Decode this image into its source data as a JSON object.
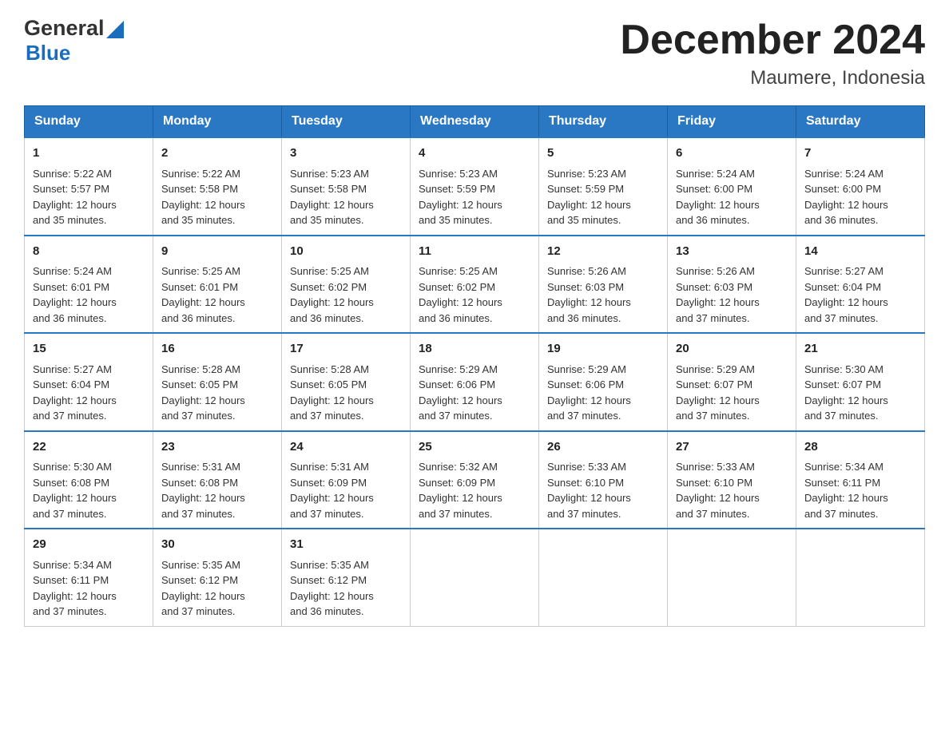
{
  "header": {
    "title": "December 2024",
    "location": "Maumere, Indonesia",
    "logo_general": "General",
    "logo_blue": "Blue"
  },
  "days_of_week": [
    "Sunday",
    "Monday",
    "Tuesday",
    "Wednesday",
    "Thursday",
    "Friday",
    "Saturday"
  ],
  "weeks": [
    [
      {
        "day": "1",
        "sunrise": "5:22 AM",
        "sunset": "5:57 PM",
        "daylight": "12 hours and 35 minutes."
      },
      {
        "day": "2",
        "sunrise": "5:22 AM",
        "sunset": "5:58 PM",
        "daylight": "12 hours and 35 minutes."
      },
      {
        "day": "3",
        "sunrise": "5:23 AM",
        "sunset": "5:58 PM",
        "daylight": "12 hours and 35 minutes."
      },
      {
        "day": "4",
        "sunrise": "5:23 AM",
        "sunset": "5:59 PM",
        "daylight": "12 hours and 35 minutes."
      },
      {
        "day": "5",
        "sunrise": "5:23 AM",
        "sunset": "5:59 PM",
        "daylight": "12 hours and 35 minutes."
      },
      {
        "day": "6",
        "sunrise": "5:24 AM",
        "sunset": "6:00 PM",
        "daylight": "12 hours and 36 minutes."
      },
      {
        "day": "7",
        "sunrise": "5:24 AM",
        "sunset": "6:00 PM",
        "daylight": "12 hours and 36 minutes."
      }
    ],
    [
      {
        "day": "8",
        "sunrise": "5:24 AM",
        "sunset": "6:01 PM",
        "daylight": "12 hours and 36 minutes."
      },
      {
        "day": "9",
        "sunrise": "5:25 AM",
        "sunset": "6:01 PM",
        "daylight": "12 hours and 36 minutes."
      },
      {
        "day": "10",
        "sunrise": "5:25 AM",
        "sunset": "6:02 PM",
        "daylight": "12 hours and 36 minutes."
      },
      {
        "day": "11",
        "sunrise": "5:25 AM",
        "sunset": "6:02 PM",
        "daylight": "12 hours and 36 minutes."
      },
      {
        "day": "12",
        "sunrise": "5:26 AM",
        "sunset": "6:03 PM",
        "daylight": "12 hours and 36 minutes."
      },
      {
        "day": "13",
        "sunrise": "5:26 AM",
        "sunset": "6:03 PM",
        "daylight": "12 hours and 37 minutes."
      },
      {
        "day": "14",
        "sunrise": "5:27 AM",
        "sunset": "6:04 PM",
        "daylight": "12 hours and 37 minutes."
      }
    ],
    [
      {
        "day": "15",
        "sunrise": "5:27 AM",
        "sunset": "6:04 PM",
        "daylight": "12 hours and 37 minutes."
      },
      {
        "day": "16",
        "sunrise": "5:28 AM",
        "sunset": "6:05 PM",
        "daylight": "12 hours and 37 minutes."
      },
      {
        "day": "17",
        "sunrise": "5:28 AM",
        "sunset": "6:05 PM",
        "daylight": "12 hours and 37 minutes."
      },
      {
        "day": "18",
        "sunrise": "5:29 AM",
        "sunset": "6:06 PM",
        "daylight": "12 hours and 37 minutes."
      },
      {
        "day": "19",
        "sunrise": "5:29 AM",
        "sunset": "6:06 PM",
        "daylight": "12 hours and 37 minutes."
      },
      {
        "day": "20",
        "sunrise": "5:29 AM",
        "sunset": "6:07 PM",
        "daylight": "12 hours and 37 minutes."
      },
      {
        "day": "21",
        "sunrise": "5:30 AM",
        "sunset": "6:07 PM",
        "daylight": "12 hours and 37 minutes."
      }
    ],
    [
      {
        "day": "22",
        "sunrise": "5:30 AM",
        "sunset": "6:08 PM",
        "daylight": "12 hours and 37 minutes."
      },
      {
        "day": "23",
        "sunrise": "5:31 AM",
        "sunset": "6:08 PM",
        "daylight": "12 hours and 37 minutes."
      },
      {
        "day": "24",
        "sunrise": "5:31 AM",
        "sunset": "6:09 PM",
        "daylight": "12 hours and 37 minutes."
      },
      {
        "day": "25",
        "sunrise": "5:32 AM",
        "sunset": "6:09 PM",
        "daylight": "12 hours and 37 minutes."
      },
      {
        "day": "26",
        "sunrise": "5:33 AM",
        "sunset": "6:10 PM",
        "daylight": "12 hours and 37 minutes."
      },
      {
        "day": "27",
        "sunrise": "5:33 AM",
        "sunset": "6:10 PM",
        "daylight": "12 hours and 37 minutes."
      },
      {
        "day": "28",
        "sunrise": "5:34 AM",
        "sunset": "6:11 PM",
        "daylight": "12 hours and 37 minutes."
      }
    ],
    [
      {
        "day": "29",
        "sunrise": "5:34 AM",
        "sunset": "6:11 PM",
        "daylight": "12 hours and 37 minutes."
      },
      {
        "day": "30",
        "sunrise": "5:35 AM",
        "sunset": "6:12 PM",
        "daylight": "12 hours and 37 minutes."
      },
      {
        "day": "31",
        "sunrise": "5:35 AM",
        "sunset": "6:12 PM",
        "daylight": "12 hours and 36 minutes."
      },
      null,
      null,
      null,
      null
    ]
  ],
  "labels": {
    "sunrise": "Sunrise:",
    "sunset": "Sunset:",
    "daylight": "Daylight:"
  }
}
